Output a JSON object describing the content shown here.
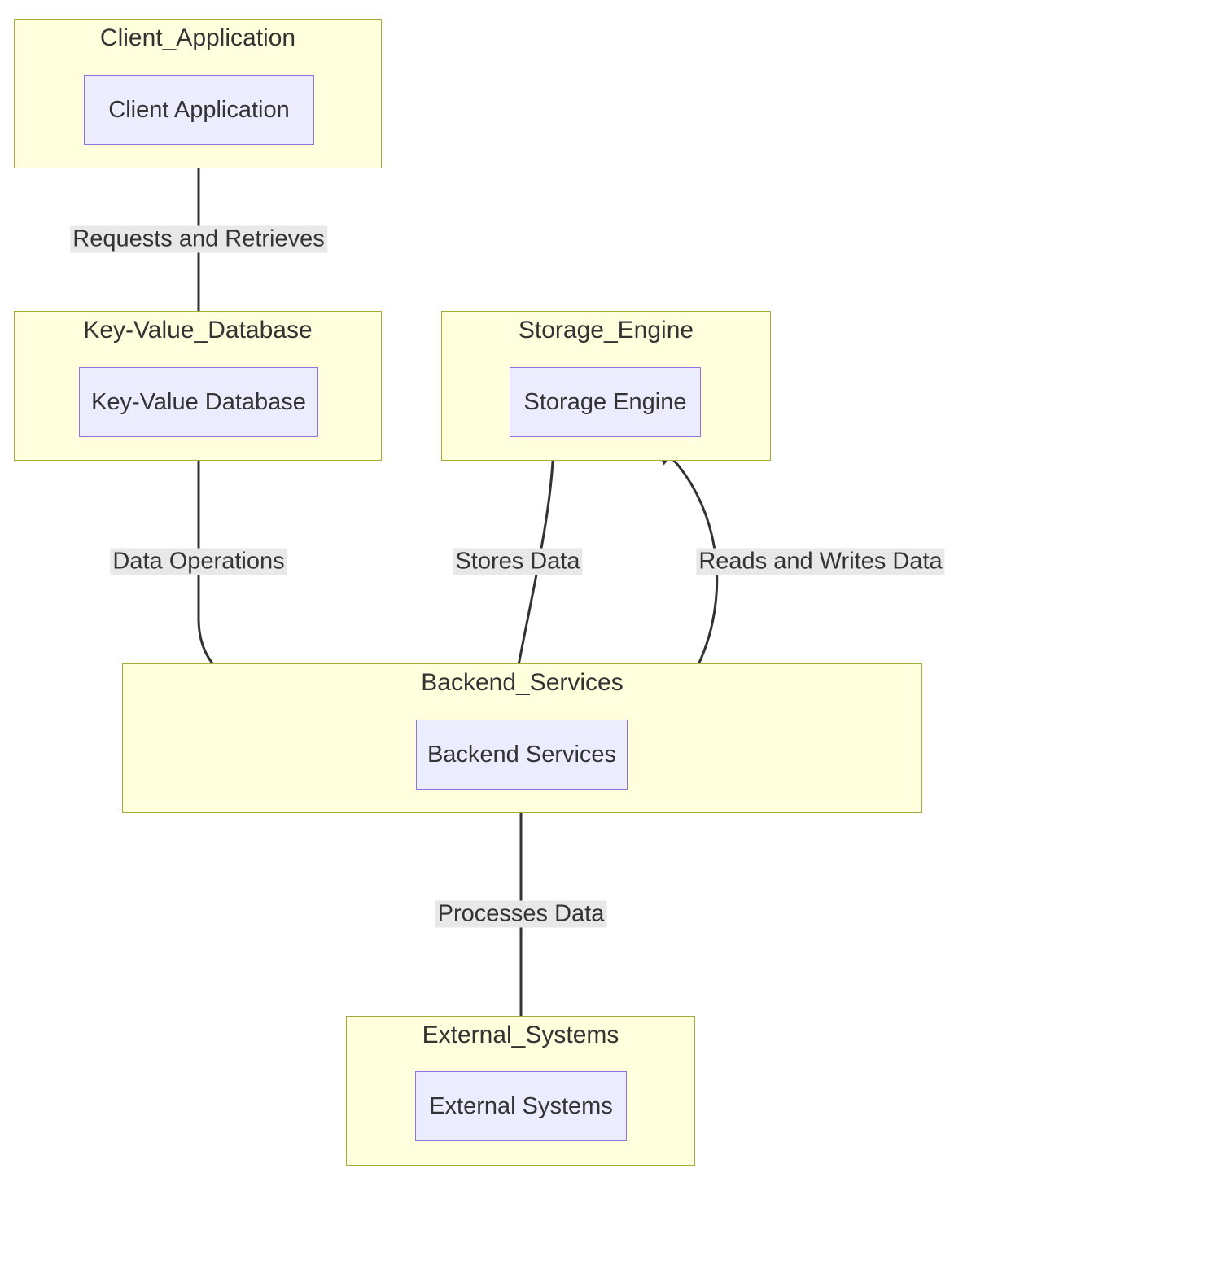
{
  "clusters": {
    "client_application": {
      "title": "Client_Application"
    },
    "key_value_database": {
      "title": "Key-Value_Database"
    },
    "storage_engine": {
      "title": "Storage_Engine"
    },
    "backend_services": {
      "title": "Backend_Services"
    },
    "external_systems": {
      "title": "External_Systems"
    }
  },
  "nodes": {
    "client_application": {
      "label": "Client Application"
    },
    "key_value_database": {
      "label": "Key-Value Database"
    },
    "storage_engine": {
      "label": "Storage Engine"
    },
    "backend_services": {
      "label": "Backend Services"
    },
    "external_systems": {
      "label": "External Systems"
    }
  },
  "edges": {
    "requests_and_retrieves": {
      "label": "Requests and Retrieves"
    },
    "data_operations": {
      "label": "Data Operations"
    },
    "stores_data": {
      "label": "Stores Data"
    },
    "reads_and_writes_data": {
      "label": "Reads and Writes Data"
    },
    "processes_data": {
      "label": "Processes Data"
    }
  },
  "diagram": {
    "type": "flowchart",
    "connections": [
      {
        "from": "client_application",
        "to": "key_value_database",
        "label_key": "requests_and_retrieves"
      },
      {
        "from": "key_value_database",
        "to": "backend_services",
        "label_key": "data_operations"
      },
      {
        "from": "storage_engine",
        "to": "backend_services",
        "label_key": "stores_data"
      },
      {
        "from": "backend_services",
        "to": "storage_engine",
        "label_key": "reads_and_writes_data"
      },
      {
        "from": "backend_services",
        "to": "external_systems",
        "label_key": "processes_data"
      }
    ]
  }
}
